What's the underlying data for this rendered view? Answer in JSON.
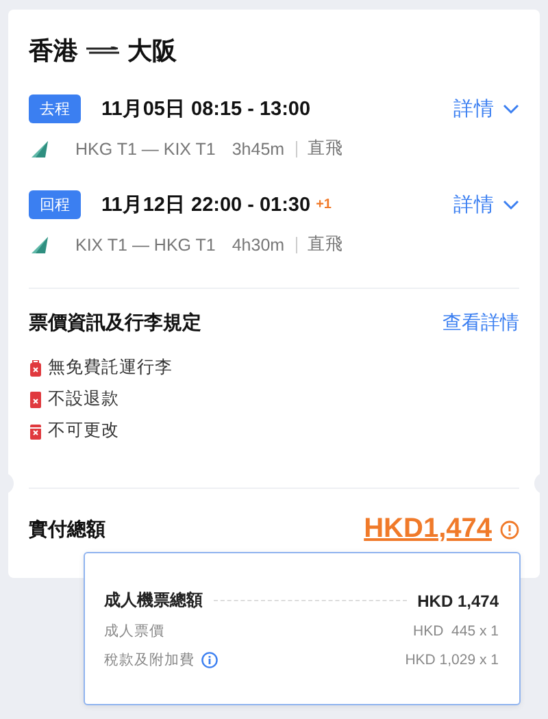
{
  "route": {
    "from": "香港",
    "to": "大阪"
  },
  "segments": [
    {
      "badge": "去程",
      "date": "11月05日",
      "times": "08:15 - 13:00",
      "details": "詳情",
      "route": "HKG T1 — KIX T1",
      "duration": "3h45m",
      "type": "直飛"
    },
    {
      "badge": "回程",
      "date": "11月12日",
      "times": "22:00 - 01:30",
      "day_offset": "+1",
      "details": "詳情",
      "route": "KIX T1 — HKG T1",
      "duration": "4h30m",
      "type": "直飛"
    }
  ],
  "fare_rules": {
    "title": "票價資訊及行李規定",
    "link": "查看詳情",
    "items": [
      {
        "kind": "baggage",
        "text": "無免費託運行李"
      },
      {
        "kind": "refund",
        "text": "不設退款"
      },
      {
        "kind": "change",
        "text": "不可更改"
      }
    ]
  },
  "total": {
    "label": "實付總額",
    "amount": "HKD1,474"
  },
  "breakdown": {
    "title": "成人機票總額",
    "amount": "HKD 1,474",
    "rows": [
      {
        "label": "成人票價",
        "value": "HKD  445 x 1",
        "info": false
      },
      {
        "label": "稅款及附加費",
        "value": "HKD 1,029 x 1",
        "info": true
      }
    ]
  }
}
